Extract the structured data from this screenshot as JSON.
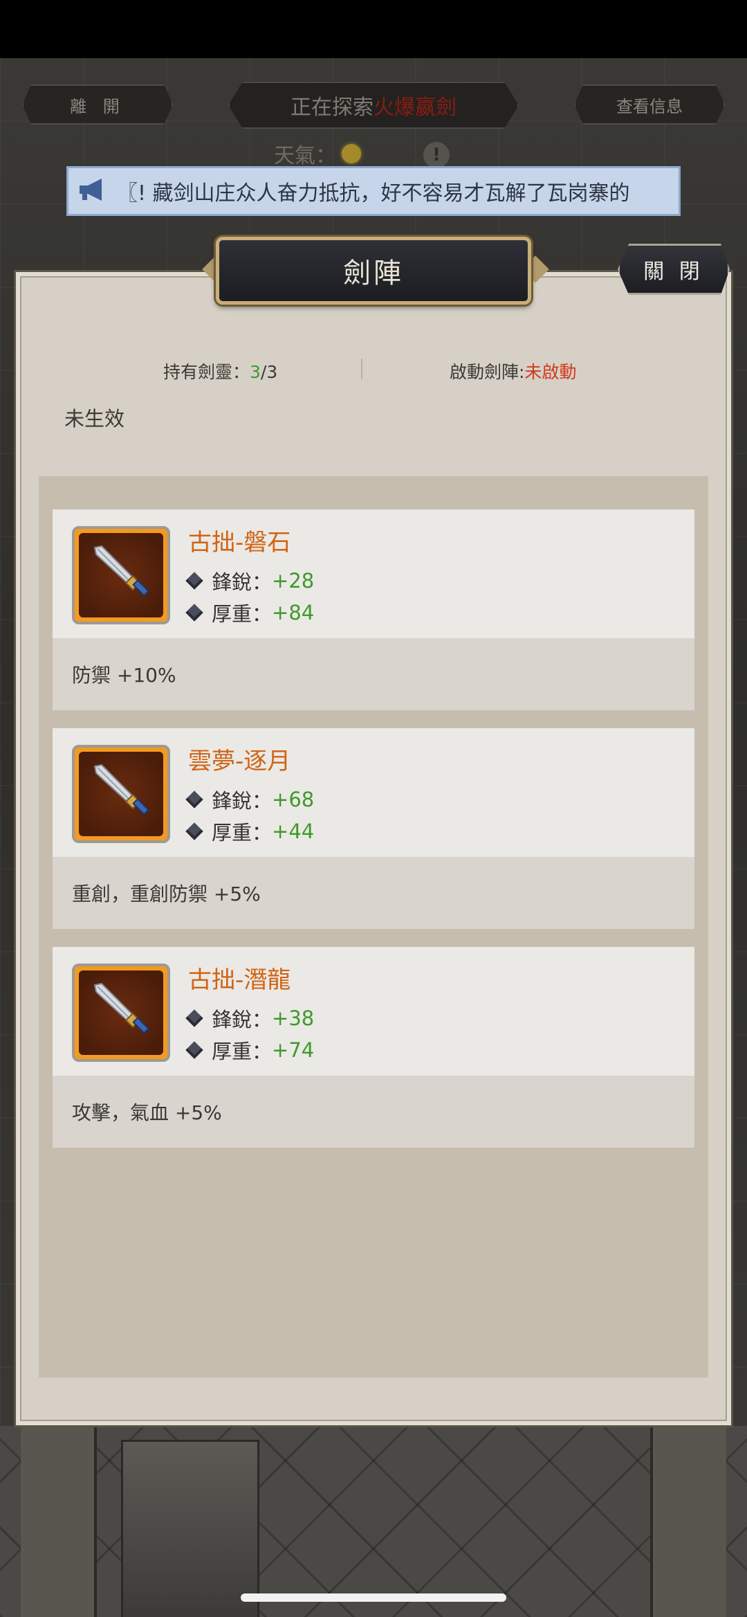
{
  "header": {
    "leave_label": "離 開",
    "explore_prefix": "正在探索",
    "explore_location": "火爆嬴劍",
    "info_label": "查看信息",
    "weather_label": "天氣："
  },
  "banner": {
    "text": "〖!  藏剑山庄众人奋力抵抗，好不容易才瓦解了瓦岗寨的"
  },
  "panel": {
    "title": "劍陣",
    "close_label": "關 閉",
    "held_label": "持有劍靈：",
    "held_count": "3",
    "held_total": "/3",
    "activate_label": "啟動劍陣:",
    "activate_state": "未啟動",
    "effect_status": "未生效"
  },
  "swords": [
    {
      "name": "古拙-磐石",
      "stat1_label": "鋒銳：",
      "stat1_value": "+28",
      "stat2_label": "厚重：",
      "stat2_value": "+84",
      "effect": "防禦 +10%"
    },
    {
      "name": "雲夢-逐月",
      "stat1_label": "鋒銳：",
      "stat1_value": "+68",
      "stat2_label": "厚重：",
      "stat2_value": "+44",
      "effect": "重創，重創防禦 +5%"
    },
    {
      "name": "古拙-潛龍",
      "stat1_label": "鋒銳：",
      "stat1_value": "+38",
      "stat2_label": "厚重：",
      "stat2_value": "+74",
      "effect": "攻擊，氣血 +5%"
    }
  ],
  "colors": {
    "accent_name": "#d06415",
    "stat_value": "#3d9a2a",
    "inactive_state": "#d23a1e",
    "item_frame": "#f39a22"
  },
  "icons": [
    "megaphone-icon",
    "sun-icon",
    "warning-icon",
    "sword-icon",
    "diamond-icon"
  ]
}
